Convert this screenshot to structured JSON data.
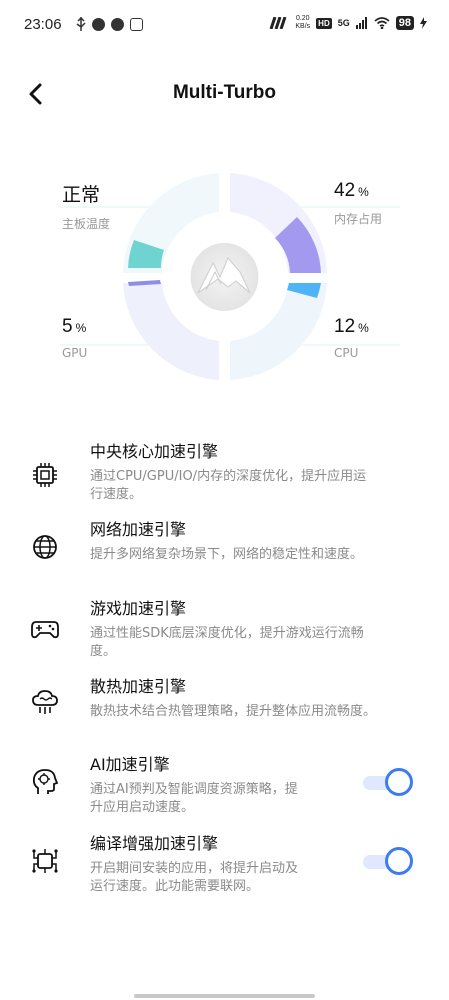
{
  "status_bar": {
    "time": "23:06",
    "left_icons": [
      "usb-icon",
      "message-icon",
      "compass-icon",
      "app-icon"
    ],
    "net_speed_value": "0.20",
    "net_speed_unit": "KB/s",
    "hd": "HD",
    "network": "5G",
    "battery": "98"
  },
  "header": {
    "back_icon": "chevron-left-icon",
    "title": "Multi-Turbo"
  },
  "gauge": {
    "board_temp": {
      "value": "正常",
      "label": "主板温度"
    },
    "memory": {
      "value": "42",
      "unit": "%",
      "label": "内存占用"
    },
    "gpu": {
      "value": "5",
      "unit": "%",
      "label": "GPU"
    },
    "cpu": {
      "value": "12",
      "unit": "%",
      "label": "CPU"
    },
    "center_icon": "turbo-logo-icon",
    "colors": {
      "temp": "#6fd3cf",
      "memory": "#a39af0",
      "gpu": "#8e8de8",
      "cpu": "#4fb4f5",
      "track": "#eef2fb"
    }
  },
  "features": [
    {
      "icon": "cpu-chip-icon",
      "title": "中央核心加速引擎",
      "desc_line1": "通过CPU/GPU/IO/内存的深度优化，提升应用运",
      "desc_line2": "行速度。",
      "toggle": null
    },
    {
      "icon": "globe-icon",
      "title": "网络加速引擎",
      "desc_line1": "提升多网络复杂场景下，网络的稳定性和速度。",
      "desc_line2": "",
      "toggle": null
    },
    {
      "icon": "gamepad-icon",
      "title": "游戏加速引擎",
      "desc_line1": "通过性能SDK底层深度优化，提升游戏运行流畅",
      "desc_line2": "度。",
      "toggle": null
    },
    {
      "icon": "cloud-heat-icon",
      "title": "散热加速引擎",
      "desc_line1": "散热技术结合热管理策略，提升整体应用流畅度。",
      "desc_line2": "",
      "toggle": null
    },
    {
      "icon": "ai-head-icon",
      "title": "AI加速引擎",
      "desc_line1": "通过AI预判及智能调度资源策略，提",
      "desc_line2": "升应用启动速度。",
      "toggle": "on"
    },
    {
      "icon": "compile-icon",
      "title": "编译增强加速引擎",
      "desc_line1": "开启期间安装的应用，将提升启动及",
      "desc_line2": "运行速度。此功能需要联网。",
      "toggle": "on"
    }
  ]
}
